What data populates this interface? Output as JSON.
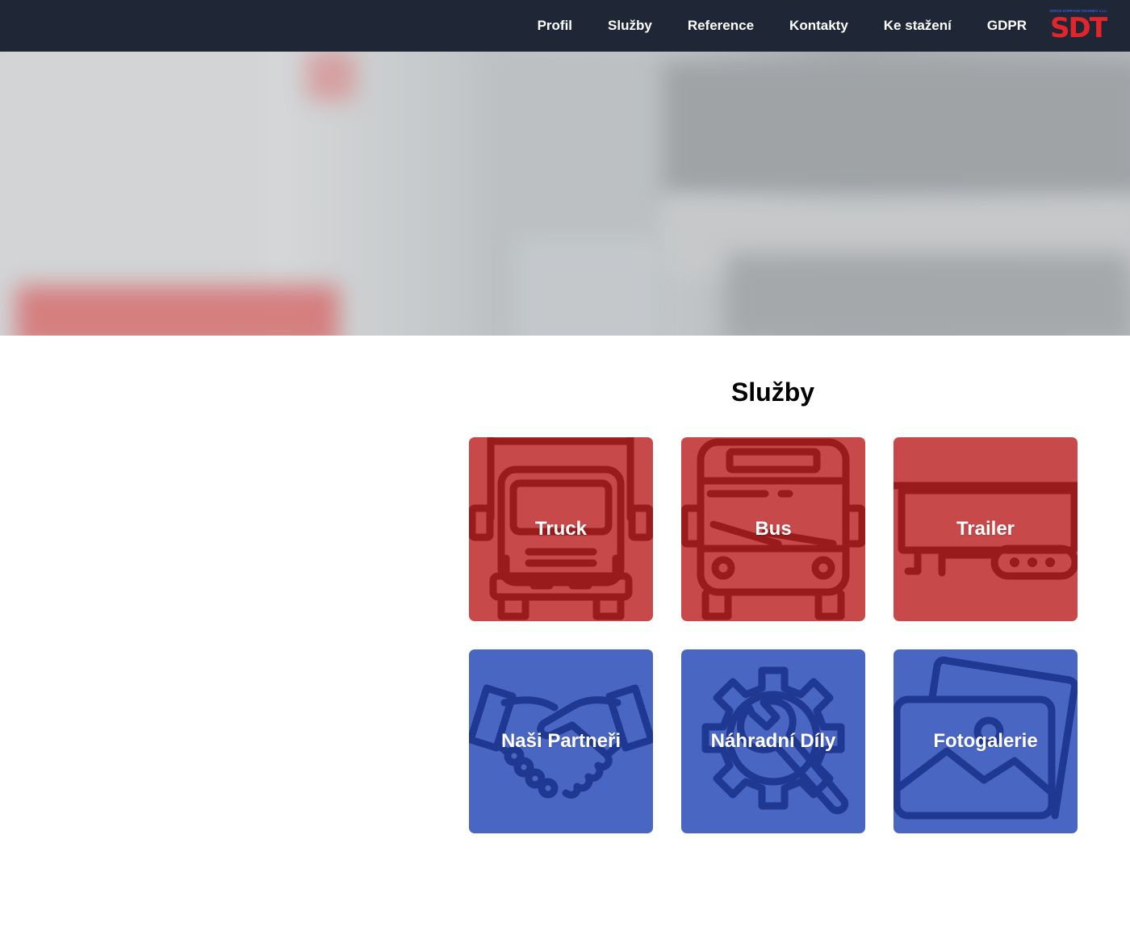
{
  "nav": {
    "items": [
      "Profil",
      "Služby",
      "Reference",
      "Kontakty",
      "Ke stažení",
      "GDPR"
    ],
    "logo_text": "SDT",
    "logo_subtext": "SERVIS DOPRAVNÍ TECHNIKY s.r.o."
  },
  "services": {
    "title": "Služby",
    "tiles": [
      {
        "label": "Truck",
        "icon": "truck-icon",
        "color": "#c7494a"
      },
      {
        "label": "Bus",
        "icon": "bus-icon",
        "color": "#c7494a"
      },
      {
        "label": "Trailer",
        "icon": "trailer-icon",
        "color": "#c7494a"
      },
      {
        "label": "Naši Partneři",
        "icon": "handshake-icon",
        "color": "#4a66c3"
      },
      {
        "label": "Náhradní Díly",
        "icon": "gear-wrench-icon",
        "color": "#4a66c3"
      },
      {
        "label": "Fotogalerie",
        "icon": "photo-gallery-icon",
        "color": "#4a66c3"
      }
    ]
  },
  "colors": {
    "header_bg": "#1f2737",
    "accent_red": "#c7494a",
    "accent_blue": "#4a66c3"
  }
}
